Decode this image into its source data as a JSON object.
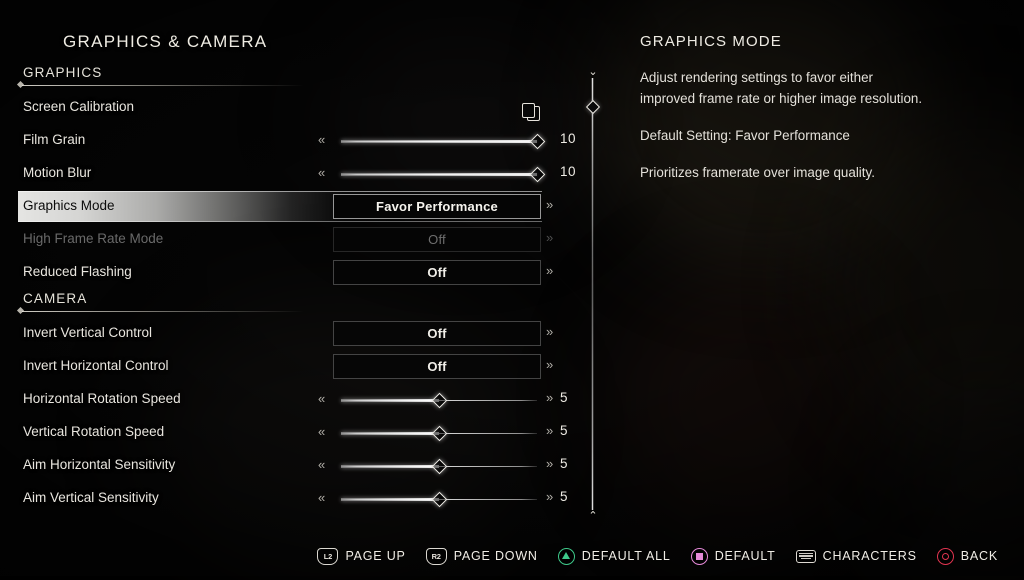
{
  "page_title": "GRAPHICS & CAMERA",
  "sections": [
    {
      "header": "GRAPHICS",
      "rows": [
        {
          "label": "Screen Calibration",
          "control": "icon",
          "icon": "pages-icon"
        },
        {
          "label": "Film Grain",
          "control": "slider",
          "value": "10",
          "percent": 100
        },
        {
          "label": "Motion Blur",
          "control": "slider",
          "value": "10",
          "percent": 100
        },
        {
          "label": "Graphics Mode",
          "control": "value",
          "value": "Favor Performance",
          "selected": true
        },
        {
          "label": "High Frame Rate Mode",
          "control": "value",
          "value": "Off",
          "disabled": true
        },
        {
          "label": "Reduced Flashing",
          "control": "value",
          "value": "Off"
        }
      ]
    },
    {
      "header": "CAMERA",
      "rows": [
        {
          "label": "Invert Vertical Control",
          "control": "value",
          "value": "Off"
        },
        {
          "label": "Invert Horizontal Control",
          "control": "value",
          "value": "Off"
        },
        {
          "label": "Horizontal Rotation Speed",
          "control": "slider",
          "value": "5",
          "percent": 50
        },
        {
          "label": "Vertical Rotation Speed",
          "control": "slider",
          "value": "5",
          "percent": 50
        },
        {
          "label": "Aim Horizontal Sensitivity",
          "control": "slider",
          "value": "5",
          "percent": 50
        },
        {
          "label": "Aim Vertical Sensitivity",
          "control": "slider",
          "value": "5",
          "percent": 50
        }
      ]
    }
  ],
  "description": {
    "title": "GRAPHICS MODE",
    "line1": "Adjust rendering settings to favor either",
    "line2": "improved frame rate or higher image resolution.",
    "line3": "Default Setting: Favor Performance",
    "line4": "Prioritizes framerate over image quality."
  },
  "scrollbar": {
    "up_arrow": "⌄",
    "down_arrow": "⌃",
    "position_percent": 6
  },
  "prompts": [
    {
      "label": "PAGE UP",
      "glyph": "shoulder",
      "glyph_text": "L2",
      "color": "#dbd8d1"
    },
    {
      "label": "PAGE DOWN",
      "glyph": "shoulder",
      "glyph_text": "R2",
      "color": "#dbd8d1"
    },
    {
      "label": "DEFAULT ALL",
      "glyph": "triangle",
      "glyph_text": "triangle-icon",
      "color": "#3ec98a"
    },
    {
      "label": "DEFAULT",
      "glyph": "square",
      "glyph_text": "square-icon",
      "color": "#e589d8"
    },
    {
      "label": "CHARACTERS",
      "glyph": "touchpad",
      "glyph_text": "touchpad-icon",
      "color": "#ddd9d2"
    },
    {
      "label": "BACK",
      "glyph": "circle",
      "glyph_text": "circle-icon",
      "color": "#e0344f"
    }
  ],
  "chevron_right": "»",
  "chevron_left": "«"
}
